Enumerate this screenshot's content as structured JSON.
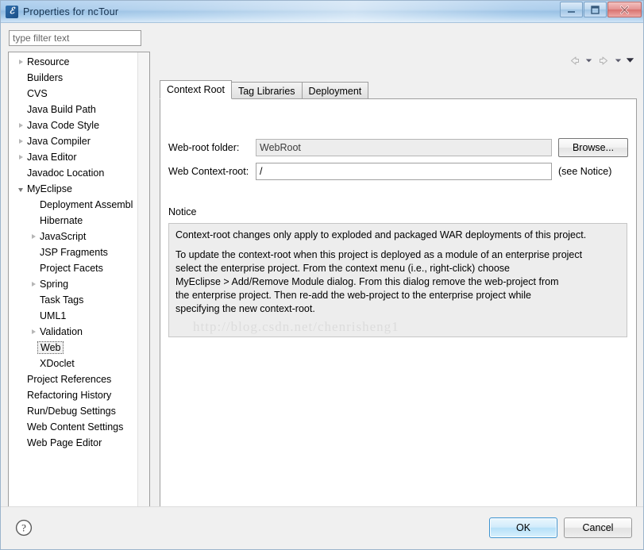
{
  "window": {
    "title": "Properties for ncTour",
    "icon": "myeclipse-icon",
    "buttons": {
      "minimize": "minimize-button",
      "maximize": "maximize-button",
      "close": "close-button"
    }
  },
  "filter": {
    "placeholder": "type filter text",
    "value": ""
  },
  "nav": {
    "back": "back-arrow-icon",
    "back_dropdown": "back-dropdown-icon",
    "forward": "forward-arrow-icon",
    "forward_dropdown": "forward-dropdown-icon",
    "menu": "view-menu-icon"
  },
  "tree": {
    "items": [
      {
        "label": "Resource",
        "indent": 0,
        "state": "collapsed",
        "selected": false
      },
      {
        "label": "Builders",
        "indent": 0,
        "state": "leaf",
        "selected": false
      },
      {
        "label": "CVS",
        "indent": 0,
        "state": "leaf",
        "selected": false
      },
      {
        "label": "Java Build Path",
        "indent": 0,
        "state": "leaf",
        "selected": false
      },
      {
        "label": "Java Code Style",
        "indent": 0,
        "state": "collapsed",
        "selected": false
      },
      {
        "label": "Java Compiler",
        "indent": 0,
        "state": "collapsed",
        "selected": false
      },
      {
        "label": "Java Editor",
        "indent": 0,
        "state": "collapsed",
        "selected": false
      },
      {
        "label": "Javadoc Location",
        "indent": 0,
        "state": "leaf",
        "selected": false
      },
      {
        "label": "MyEclipse",
        "indent": 0,
        "state": "expanded",
        "selected": false
      },
      {
        "label": "Deployment Assembl",
        "indent": 1,
        "state": "leaf",
        "selected": false
      },
      {
        "label": "Hibernate",
        "indent": 1,
        "state": "leaf",
        "selected": false
      },
      {
        "label": "JavaScript",
        "indent": 1,
        "state": "collapsed",
        "selected": false
      },
      {
        "label": "JSP Fragments",
        "indent": 1,
        "state": "leaf",
        "selected": false
      },
      {
        "label": "Project Facets",
        "indent": 1,
        "state": "leaf",
        "selected": false
      },
      {
        "label": "Spring",
        "indent": 1,
        "state": "collapsed",
        "selected": false
      },
      {
        "label": "Task Tags",
        "indent": 1,
        "state": "leaf",
        "selected": false
      },
      {
        "label": "UML1",
        "indent": 1,
        "state": "leaf",
        "selected": false
      },
      {
        "label": "Validation",
        "indent": 1,
        "state": "collapsed",
        "selected": false
      },
      {
        "label": "Web",
        "indent": 1,
        "state": "leaf",
        "selected": true
      },
      {
        "label": "XDoclet",
        "indent": 1,
        "state": "leaf",
        "selected": false
      },
      {
        "label": "Project References",
        "indent": 0,
        "state": "leaf",
        "selected": false
      },
      {
        "label": "Refactoring History",
        "indent": 0,
        "state": "leaf",
        "selected": false
      },
      {
        "label": "Run/Debug Settings",
        "indent": 0,
        "state": "leaf",
        "selected": false
      },
      {
        "label": "Web Content Settings",
        "indent": 0,
        "state": "leaf",
        "selected": false
      },
      {
        "label": "Web Page Editor",
        "indent": 0,
        "state": "leaf",
        "selected": false
      }
    ]
  },
  "tabs": [
    {
      "label": "Context Root",
      "active": true
    },
    {
      "label": "Tag Libraries",
      "active": false
    },
    {
      "label": "Deployment",
      "active": false
    }
  ],
  "form": {
    "webroot_label": "Web-root folder:",
    "webroot_value": "WebRoot",
    "webroot_disabled": true,
    "browse_label": "Browse...",
    "ctxroot_label": "Web Context-root:",
    "ctxroot_value": "/",
    "ctxroot_hint": "(see Notice)"
  },
  "notice": {
    "title": "Notice",
    "lines": [
      "Context-root changes only apply to exploded and packaged WAR deployments of this project.",
      "",
      "To update the context-root when this project is deployed as a module of an enterprise project",
      "select the enterprise project. From the context menu (i.e., right-click) choose",
      "MyEclipse > Add/Remove Module dialog. From this dialog remove the web-project from",
      "the enterprise project. Then re-add the web-project to the enterprise project while",
      "specifying the new context-root."
    ]
  },
  "watermark": "http://blog.csdn.net/chenrisheng1",
  "footer": {
    "help": "help-icon",
    "ok_label": "OK",
    "cancel_label": "Cancel"
  },
  "colors": {
    "title_accent": "#8fbbe2",
    "default_button": "#3c93d0",
    "close_button": "#d8726f",
    "notice_bg": "#ededed"
  }
}
